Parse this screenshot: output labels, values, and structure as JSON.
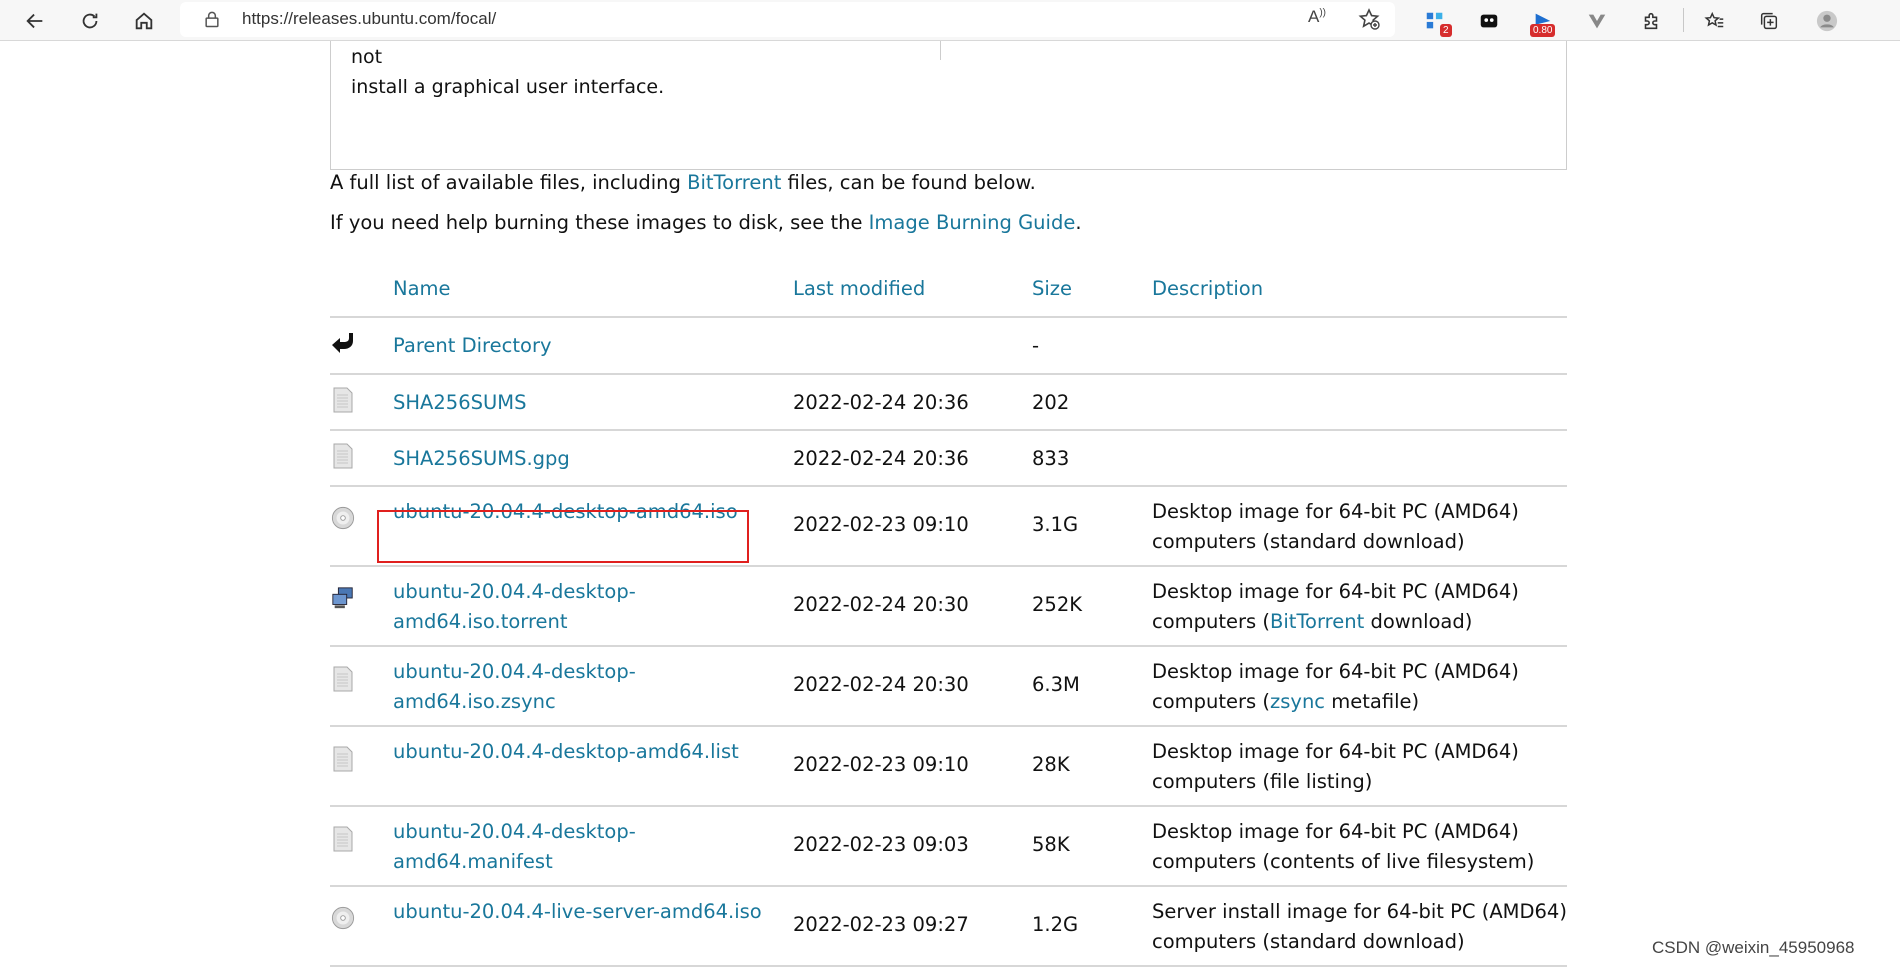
{
  "browser": {
    "url": "https://releases.ubuntu.com/focal/",
    "read_aloud_label": "A",
    "badges": {
      "ext_count": "2",
      "ext_score": "0.80"
    }
  },
  "intro": {
    "text_line1": "permanently on a computer for use as a server. It will not",
    "text_line2": "install a graphical user interface."
  },
  "info": {
    "line1_before": "A full list of available files, including ",
    "line1_link": "BitTorrent",
    "line1_after": " files, can be found below.",
    "line2_before": "If you need help burning these images to disk, see the ",
    "line2_link": "Image Burning Guide",
    "line2_after": "."
  },
  "table": {
    "headers": {
      "name": "Name",
      "modified": "Last modified",
      "size": "Size",
      "description": "Description"
    },
    "rows": [
      {
        "icon": "back-arrow-icon",
        "name_l1": "Parent Directory",
        "name_l2": "",
        "modified": "",
        "size": "-",
        "d1a": "",
        "d1l": "",
        "d1b": "",
        "d2a": "",
        "d2l": "",
        "d2b": ""
      },
      {
        "icon": "text-file-icon",
        "name_l1": "SHA256SUMS",
        "name_l2": "",
        "modified": "2022-02-24 20:36",
        "size": "202",
        "d1a": "",
        "d1l": "",
        "d1b": "",
        "d2a": "",
        "d2l": "",
        "d2b": ""
      },
      {
        "icon": "text-file-icon",
        "name_l1": "SHA256SUMS.gpg",
        "name_l2": "",
        "modified": "2022-02-24 20:36",
        "size": "833",
        "d1a": "",
        "d1l": "",
        "d1b": "",
        "d2a": "",
        "d2l": "",
        "d2b": ""
      },
      {
        "icon": "disc-icon",
        "name_l1": "ubuntu-20.04.4-desktop-amd64.iso",
        "name_l2": "",
        "modified": "2022-02-23 09:10",
        "size": "3.1G",
        "d1a": "Desktop image for 64-bit PC (AMD64)",
        "d1l": "",
        "d1b": "",
        "d2a": "computers (standard download)",
        "d2l": "",
        "d2b": ""
      },
      {
        "icon": "network-computer-icon",
        "name_l1": "ubuntu-20.04.4-desktop-",
        "name_l2": "amd64.iso.torrent",
        "modified": "2022-02-24 20:30",
        "size": "252K",
        "d1a": "Desktop image for 64-bit PC (AMD64)",
        "d1l": "",
        "d1b": "",
        "d2a": "computers (",
        "d2l": "BitTorrent",
        "d2b": " download)"
      },
      {
        "icon": "text-file-icon",
        "name_l1": "ubuntu-20.04.4-desktop-amd64.iso.zsync",
        "name_l2": "",
        "modified": "2022-02-24 20:30",
        "size": "6.3M",
        "d1a": "Desktop image for 64-bit PC (AMD64)",
        "d1l": "",
        "d1b": "",
        "d2a": "computers (",
        "d2l": "zsync",
        "d2b": " metafile)"
      },
      {
        "icon": "text-file-icon",
        "name_l1": "ubuntu-20.04.4-desktop-amd64.list",
        "name_l2": "",
        "modified": "2022-02-23 09:10",
        "size": "28K",
        "d1a": "Desktop image for 64-bit PC (AMD64)",
        "d1l": "",
        "d1b": "",
        "d2a": "computers (file listing)",
        "d2l": "",
        "d2b": ""
      },
      {
        "icon": "text-file-icon",
        "name_l1": "ubuntu-20.04.4-desktop-amd64.manifest",
        "name_l2": "",
        "modified": "2022-02-23 09:03",
        "size": "58K",
        "d1a": "Desktop image for 64-bit PC (AMD64)",
        "d1l": "",
        "d1b": "",
        "d2a": "computers (contents of live filesystem)",
        "d2l": "",
        "d2b": ""
      },
      {
        "icon": "disc-icon",
        "name_l1": "ubuntu-20.04.4-live-server-amd64.iso",
        "name_l2": "",
        "modified": "2022-02-23 09:27",
        "size": "1.2G",
        "d1a": "Server install image for 64-bit PC (AMD64)",
        "d1l": "",
        "d1b": "",
        "d2a": "computers (standard download)",
        "d2l": "",
        "d2b": ""
      }
    ]
  },
  "watermark": "CSDN @weixin_45950968",
  "colors": {
    "link": "#19779b",
    "highlight": "#e0201e"
  }
}
